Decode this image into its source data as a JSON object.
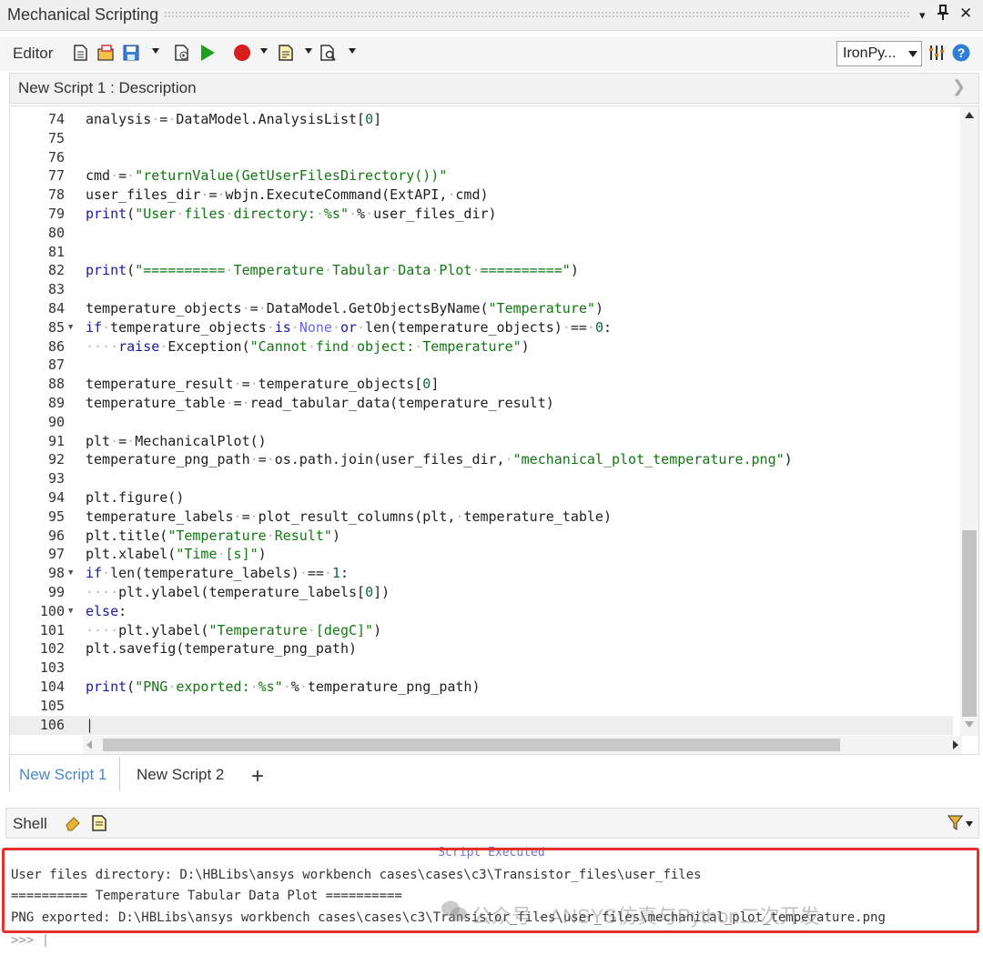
{
  "window": {
    "title": "Mechanical Scripting",
    "controls": [
      "▾",
      "📌",
      "✕"
    ]
  },
  "toolbar": {
    "editor_label": "Editor",
    "language_value": "IronPy...",
    "icons": [
      "new-script-icon",
      "open-icon",
      "save-icon",
      "debug-icon",
      "run-icon",
      "record-icon",
      "snippet-icon",
      "find-icon",
      "settings-icon",
      "help-icon"
    ]
  },
  "description": {
    "text": "New Script 1 : Description"
  },
  "editor": {
    "lines": [
      {
        "num": "74",
        "html": "analysis<span class='ws'>·</span>=<span class='ws'>·</span>DataModel.AnalysisList[<span class='m'>0</span>]"
      },
      {
        "num": "75",
        "html": ""
      },
      {
        "num": "76",
        "html": ""
      },
      {
        "num": "77",
        "html": "cmd<span class='ws'>·</span>=<span class='ws'>·</span><span class='s'>\"returnValue(GetUserFilesDirectory())\"</span>"
      },
      {
        "num": "78",
        "html": "user_files_dir<span class='ws'>·</span>=<span class='ws'>·</span>wbjn.ExecuteCommand(ExtAPI,<span class='ws'>·</span>cmd)"
      },
      {
        "num": "79",
        "html": "<span class='k'>print</span>(<span class='s'>\"User<span class='ws'>·</span>files<span class='ws'>·</span>directory:<span class='ws'>·</span>%s\"</span><span class='ws'>·</span>%<span class='ws'>·</span>user_files_dir)"
      },
      {
        "num": "80",
        "html": ""
      },
      {
        "num": "81",
        "html": ""
      },
      {
        "num": "82",
        "html": "<span class='k'>print</span>(<span class='s'>\"==========<span class='ws'>·</span>Temperature<span class='ws'>·</span>Tabular<span class='ws'>·</span>Data<span class='ws'>·</span>Plot<span class='ws'>·</span>==========\"</span>)"
      },
      {
        "num": "83",
        "html": ""
      },
      {
        "num": "84",
        "html": "temperature_objects<span class='ws'>·</span>=<span class='ws'>·</span>DataModel.GetObjectsByName(<span class='s'>\"Temperature\"</span>)"
      },
      {
        "num": "85",
        "fold": true,
        "html": "<span class='k'>if</span><span class='ws'>·</span>temperature_objects<span class='ws'>·</span><span class='k'>is</span><span class='ws'>·</span><span class='n'>None</span><span class='ws'>·</span><span class='k'>or</span><span class='ws'>·</span>len(temperature_objects)<span class='ws'>·</span>==<span class='ws'>·</span><span class='m'>0</span>:"
      },
      {
        "num": "86",
        "html": "<span class='ws'>····</span><span class='k'>raise</span><span class='ws'>·</span>Exception(<span class='s'>\"Cannot<span class='ws'>·</span>find<span class='ws'>·</span>object:<span class='ws'>·</span>Temperature\"</span>)"
      },
      {
        "num": "87",
        "html": ""
      },
      {
        "num": "88",
        "html": "temperature_result<span class='ws'>·</span>=<span class='ws'>·</span>temperature_objects[<span class='m'>0</span>]"
      },
      {
        "num": "89",
        "html": "temperature_table<span class='ws'>·</span>=<span class='ws'>·</span>read_tabular_data(temperature_result)"
      },
      {
        "num": "90",
        "html": ""
      },
      {
        "num": "91",
        "html": "plt<span class='ws'>·</span>=<span class='ws'>·</span>MechanicalPlot()"
      },
      {
        "num": "92",
        "html": "temperature_png_path<span class='ws'>·</span>=<span class='ws'>·</span>os.path.join(user_files_dir,<span class='ws'>·</span><span class='s'>\"mechanical_plot_temperature.png\"</span>)"
      },
      {
        "num": "93",
        "html": ""
      },
      {
        "num": "94",
        "html": "plt.figure()"
      },
      {
        "num": "95",
        "html": "temperature_labels<span class='ws'>·</span>=<span class='ws'>·</span>plot_result_columns(plt,<span class='ws'>·</span>temperature_table)"
      },
      {
        "num": "96",
        "html": "plt.title(<span class='s'>\"Temperature<span class='ws'>·</span>Result\"</span>)"
      },
      {
        "num": "97",
        "html": "plt.xlabel(<span class='s'>\"Time<span class='ws'>·</span>[s]\"</span>)"
      },
      {
        "num": "98",
        "fold": true,
        "html": "<span class='k'>if</span><span class='ws'>·</span>len(temperature_labels)<span class='ws'>·</span>==<span class='ws'>·</span><span class='m'>1</span>:"
      },
      {
        "num": "99",
        "html": "<span class='ws'>····</span>plt.ylabel(temperature_labels[<span class='m'>0</span>])"
      },
      {
        "num": "100",
        "fold": true,
        "html": "<span class='k'>else</span>:"
      },
      {
        "num": "101",
        "html": "<span class='ws'>····</span>plt.ylabel(<span class='s'>\"Temperature<span class='ws'>·</span>[degC]\"</span>)"
      },
      {
        "num": "102",
        "html": "plt.savefig(temperature_png_path)"
      },
      {
        "num": "103",
        "html": ""
      },
      {
        "num": "104",
        "html": "<span class='k'>print</span>(<span class='s'>\"PNG<span class='ws'>·</span>exported:<span class='ws'>·</span>%s\"</span><span class='ws'>·</span>%<span class='ws'>·</span>temperature_png_path)"
      },
      {
        "num": "105",
        "html": ""
      },
      {
        "num": "106",
        "active": true,
        "html": ""
      }
    ]
  },
  "tabs": {
    "items": [
      {
        "label": "New Script 1",
        "active": true
      },
      {
        "label": "New Script 2",
        "active": false
      }
    ],
    "add_label": "+"
  },
  "shell": {
    "label": "Shell",
    "status": "Script Executed",
    "output": [
      "User files directory: D:\\HBLibs\\ansys workbench cases\\cases\\c3\\Transistor_files\\user_files",
      "========== Temperature Tabular Data Plot ==========",
      "PNG exported: D:\\HBLibs\\ansys workbench cases\\cases\\c3\\Transistor_files\\user_files\\mechanical_plot_temperature.png"
    ],
    "prompt": ">>> |"
  },
  "watermark": {
    "text": "公众号 · ANSYS仿真与Python二次开发"
  },
  "colors": {
    "highlight": "#e5302c",
    "keyword": "#1a1aa6",
    "string": "#117711",
    "active_tab": "#4a86c8"
  }
}
